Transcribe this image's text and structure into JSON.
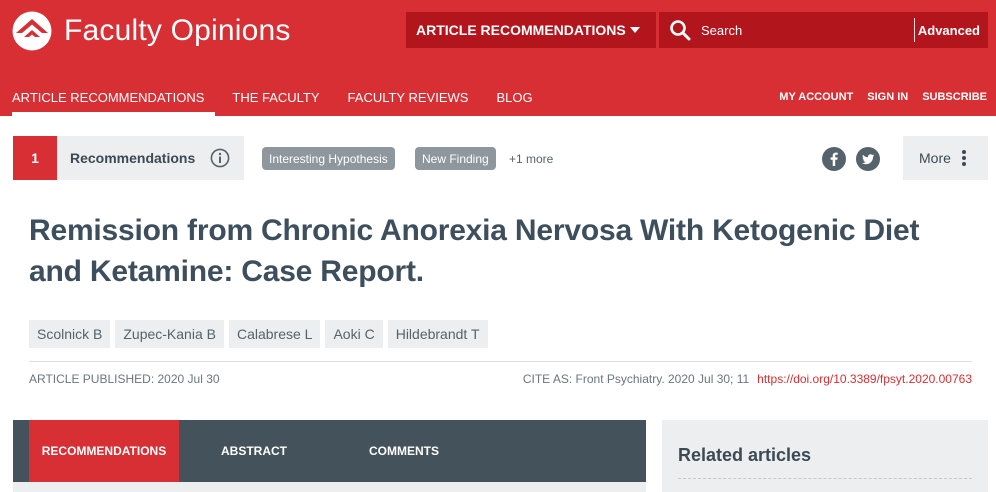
{
  "brand": {
    "name": "Faculty Opinions"
  },
  "header": {
    "dropdown_label": "ARTICLE RECOMMENDATIONS",
    "search_placeholder": "Search",
    "advanced_label": "Advanced"
  },
  "nav": {
    "items": [
      {
        "label": "ARTICLE RECOMMENDATIONS",
        "active": true
      },
      {
        "label": "THE FACULTY",
        "active": false
      },
      {
        "label": "FACULTY REVIEWS",
        "active": false
      },
      {
        "label": "BLOG",
        "active": false
      }
    ],
    "account": [
      "MY ACCOUNT",
      "SIGN IN",
      "SUBSCRIBE"
    ]
  },
  "recommendations": {
    "count": "1",
    "label": "Recommendations",
    "tags": [
      "Interesting Hypothesis",
      "New Finding"
    ],
    "more_tags": "+1 more"
  },
  "share": {
    "icons": [
      "facebook-icon",
      "twitter-icon"
    ]
  },
  "more_menu": {
    "label": "More"
  },
  "article": {
    "title": "Remission from Chronic Anorexia Nervosa With Ketogenic Diet and Ketamine: Case Report.",
    "authors": [
      "Scolnick B",
      "Zupec-Kania B",
      "Calabrese L",
      "Aoki C",
      "Hildebrandt T"
    ],
    "published": "ARTICLE PUBLISHED: 2020 Jul 30",
    "cite_as": "CITE AS: Front Psychiatry. 2020 Jul 30; 11",
    "doi": "https://doi.org/10.3389/fpsyt.2020.00763"
  },
  "tabs": [
    {
      "label": "RECOMMENDATIONS",
      "active": true
    },
    {
      "label": "ABSTRACT",
      "active": false
    },
    {
      "label": "COMMENTS",
      "active": false
    }
  ],
  "sidebar": {
    "related_title": "Related articles"
  },
  "colors": {
    "brand_red": "#d72f33",
    "dark_red": "#b3151d",
    "slate": "#44525c",
    "title_text": "#3d4f5c",
    "tag_gray": "#8d979d"
  }
}
